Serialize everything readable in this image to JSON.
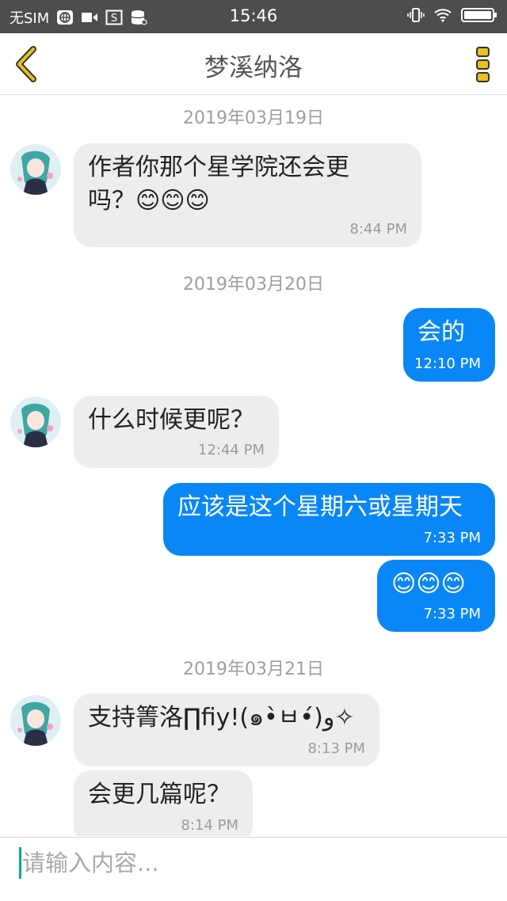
{
  "status_bar": {
    "carrier": "无SIM",
    "time": "15:46",
    "left_icons": [
      "globe-icon",
      "video-icon",
      "s-icon",
      "storage-icon"
    ],
    "right_icons": [
      "vibrate-icon",
      "wifi-icon",
      "battery-icon"
    ]
  },
  "header": {
    "title": "梦溪纳洛",
    "accent_color": "#e6c21e"
  },
  "colors": {
    "outgoing_bubble": "#0a87f7",
    "incoming_bubble": "#ededed"
  },
  "messages": [
    {
      "type": "date",
      "text": "2019年03月19日"
    },
    {
      "type": "in",
      "text": "作者你那个星学院还会更\n吗？😊😊😊",
      "time": "8:44 PM"
    },
    {
      "type": "date",
      "text": "2019年03月20日"
    },
    {
      "type": "out",
      "text": "会的",
      "time": "12:10 PM"
    },
    {
      "type": "in",
      "text": "什么时候更呢？",
      "time": "12:44 PM"
    },
    {
      "type": "out",
      "text": "应该是这个星期六或星期天",
      "time": "7:33 PM"
    },
    {
      "type": "out",
      "text": "😊😊😊",
      "time": "7:33 PM"
    },
    {
      "type": "date",
      "text": "2019年03月21日"
    },
    {
      "type": "in",
      "text": "支持箐洛∏ﬁy!(๑•̀ㅂ•́)و✧",
      "time": "8:13 PM"
    },
    {
      "type": "in",
      "text": "会更几篇呢？",
      "time": "8:14 PM"
    }
  ],
  "input": {
    "placeholder": "请输入内容...",
    "value": ""
  }
}
